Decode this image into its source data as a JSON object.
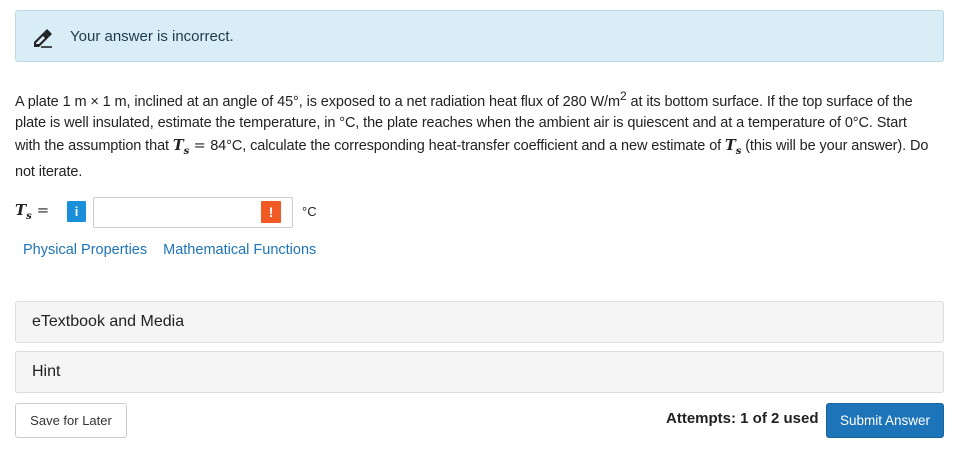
{
  "alert": {
    "icon": "eraser-pencil-icon",
    "message": "Your answer is incorrect."
  },
  "question": {
    "part1": "A plate 1 m × 1 m, inclined at an angle of 45°, is exposed to a net radiation heat flux of 280 W/m",
    "sup2": "2",
    "part2": " at its bottom surface. If the top surface of the plate is well insulated, estimate the temperature, in °C, the plate reaches when the ambient air is quiescent and at a temperature of 0°C. Start with the assumption that ",
    "var_T": "T",
    "var_sub": "s",
    "eq": " = ",
    "part3": "84°C, calculate the corresponding heat-transfer coefficient and a new estimate of ",
    "part4": " (this will be your answer). Do not iterate."
  },
  "answer": {
    "label_T": "T",
    "label_sub": "s",
    "label_eq": " =",
    "info_glyph": "i",
    "value": "",
    "warn_glyph": "!",
    "unit": "°C"
  },
  "links": {
    "physical": "Physical Properties",
    "math": "Mathematical Functions"
  },
  "accordions": {
    "etextbook": "eTextbook and Media",
    "hint": "Hint"
  },
  "footer": {
    "save": "Save for Later",
    "attempts": "Attempts: 1 of 2 used",
    "submit": "Submit Answer"
  },
  "colors": {
    "alert_bg": "#d9edf7",
    "link": "#1e74b8",
    "info": "#1a8fd9",
    "warn": "#f15a24",
    "submit": "#1e74b8"
  }
}
